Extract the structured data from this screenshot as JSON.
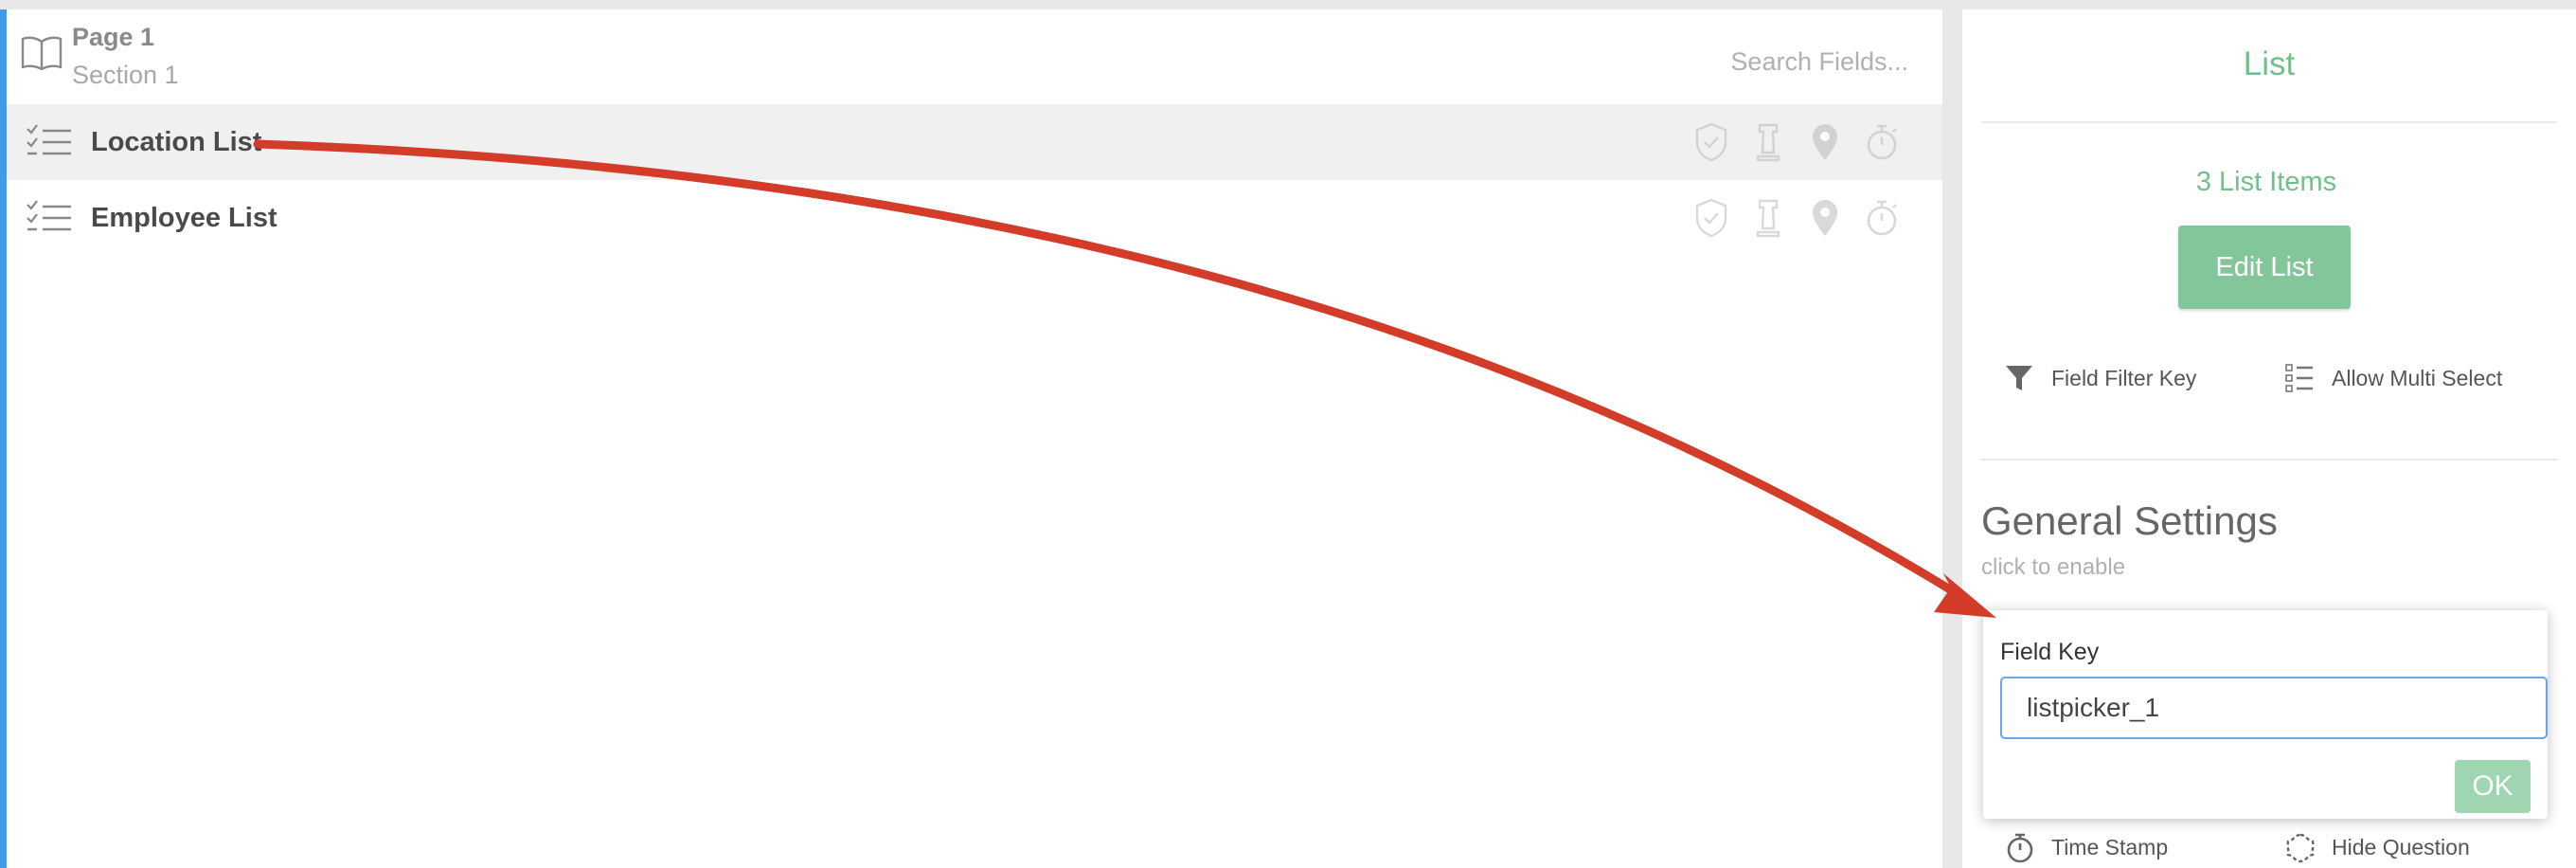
{
  "header": {
    "page_title": "Page 1",
    "section_title": "Section 1",
    "search_placeholder": "Search Fields..."
  },
  "fields": [
    {
      "label": "Location List",
      "icon": "checklist-icon",
      "selected": true
    },
    {
      "label": "Employee List",
      "icon": "checklist-icon",
      "selected": false
    }
  ],
  "row_action_icons": [
    "shield-check-icon",
    "chess-rook-icon",
    "map-pin-icon",
    "stopwatch-icon"
  ],
  "panel": {
    "title": "List",
    "list_count": "3 List Items",
    "edit_button": "Edit List",
    "field_filter_key": "Field Filter Key",
    "allow_multi_select": "Allow Multi Select",
    "general_settings_title": "General Settings",
    "general_settings_sub": "click to enable",
    "time_stamp": "Time Stamp",
    "hide_question": "Hide Question"
  },
  "popover": {
    "label": "Field Key",
    "value": "listpicker_1",
    "ok_button": "OK"
  },
  "colors": {
    "accent_green": "#6fc08b",
    "button_green": "#82c699",
    "left_accent_blue": "#3d9be9",
    "annotation_arrow": "#d23c28"
  }
}
